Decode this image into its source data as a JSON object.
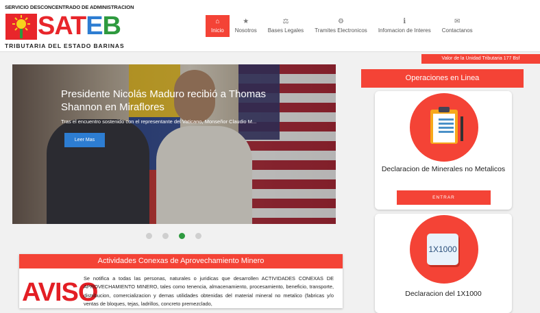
{
  "header": {
    "logo_top": "SERVICIO DESCONCENTRADO DE ADMINISTRACION",
    "logo_word": "SATEB",
    "logo_bottom": "TRIBUTARIA DEL ESTADO BARINAS",
    "nav": [
      {
        "label": "Inicio",
        "icon": "home-icon",
        "active": true
      },
      {
        "label": "Nosotros",
        "icon": "star-icon",
        "active": false
      },
      {
        "label": "Bases Legales",
        "icon": "scale-icon",
        "active": false
      },
      {
        "label": "Tramites Electronicos",
        "icon": "gear-icon",
        "active": false
      },
      {
        "label": "Infomacion de Interes",
        "icon": "info-icon",
        "active": false
      },
      {
        "label": "Contactanos",
        "icon": "envelope-icon",
        "active": false
      }
    ],
    "uvt_text": "Valor de la Unidad Tributaria 177 Bsf"
  },
  "slider": {
    "title": "Presidente Nicolás Maduro recibió a Thomas Shannon en Miraflores",
    "subtitle": "Tras el encuentro sostenido con el representante del Vaticano, Monseñor Claudio M...",
    "button": "Leer Mas",
    "dots": 4,
    "active_dot": 2
  },
  "news": {
    "header": "Actividades Conexas de Aprovechamiento Minero",
    "aviso": "AVISO",
    "text": "Se notifica a todas las personas, naturales o juridicas que desarrollen ACTIVIDADES CONEXAS DE APROVECHAMIENTO MINERO, tales como tenencia, almacenamiento, procesamiento, beneficio, transporte, distribucion, comercializacion y demas utilidades obtenidas del material mineral no metalico (fabricas y/o ventas de bloques, tejas, ladrillos, concreto premezclado,"
  },
  "operations": {
    "header": "Operaciones en Linea",
    "items": [
      {
        "title": "Declaracion de Minerales no Metalicos",
        "button": "ENTRAR",
        "icon": "clipboard-icon"
      },
      {
        "title": "Declaracion del 1X1000",
        "icon_text": "1X1000",
        "icon": "calculator-icon"
      }
    ]
  },
  "colors": {
    "accent": "#f44336",
    "active_dot": "#2e9a3f",
    "button_blue": "#2d7dd2"
  }
}
